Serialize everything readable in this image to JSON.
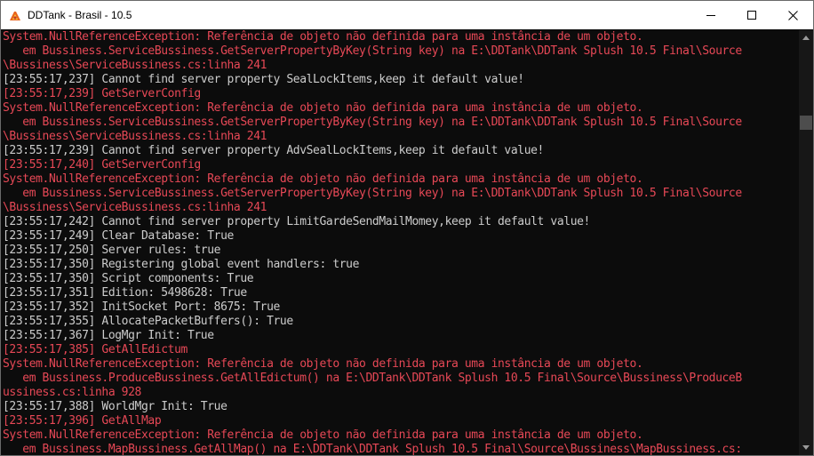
{
  "window": {
    "title": "DDTank - Brasil - 10.5",
    "icon": "ddtank-app-icon",
    "controls": [
      "minimize-icon",
      "maximize-icon",
      "close-icon"
    ]
  },
  "colors": {
    "background": "#0c0c0c",
    "text_normal": "#cccccc",
    "text_error": "#e74856",
    "titlebar": "#ffffff"
  },
  "console": {
    "lines": [
      {
        "text": "System.NullReferenceException: Referência de objeto não definida para uma instância de um objeto.",
        "color": "#e74856"
      },
      {
        "text": "   em Bussiness.ServiceBussiness.GetServerPropertyByKey(String key) na E:\\DDTank\\DDTank Splush 10.5 Final\\Source",
        "color": "#e74856"
      },
      {
        "text": "\\Bussiness\\ServiceBussiness.cs:linha 241",
        "color": "#e74856"
      },
      {
        "text": "[23:55:17,237] Cannot find server property SealLockItems,keep it default value!",
        "color": "#cccccc"
      },
      {
        "text": "[23:55:17,239] GetServerConfig",
        "color": "#e74856"
      },
      {
        "text": "System.NullReferenceException: Referência de objeto não definida para uma instância de um objeto.",
        "color": "#e74856"
      },
      {
        "text": "   em Bussiness.ServiceBussiness.GetServerPropertyByKey(String key) na E:\\DDTank\\DDTank Splush 10.5 Final\\Source",
        "color": "#e74856"
      },
      {
        "text": "\\Bussiness\\ServiceBussiness.cs:linha 241",
        "color": "#e74856"
      },
      {
        "text": "[23:55:17,239] Cannot find server property AdvSealLockItems,keep it default value!",
        "color": "#cccccc"
      },
      {
        "text": "[23:55:17,240] GetServerConfig",
        "color": "#e74856"
      },
      {
        "text": "System.NullReferenceException: Referência de objeto não definida para uma instância de um objeto.",
        "color": "#e74856"
      },
      {
        "text": "   em Bussiness.ServiceBussiness.GetServerPropertyByKey(String key) na E:\\DDTank\\DDTank Splush 10.5 Final\\Source",
        "color": "#e74856"
      },
      {
        "text": "\\Bussiness\\ServiceBussiness.cs:linha 241",
        "color": "#e74856"
      },
      {
        "text": "[23:55:17,242] Cannot find server property LimitGardeSendMailMomey,keep it default value!",
        "color": "#cccccc"
      },
      {
        "text": "[23:55:17,249] Clear Database: True",
        "color": "#cccccc"
      },
      {
        "text": "[23:55:17,250] Server rules: true",
        "color": "#cccccc"
      },
      {
        "text": "[23:55:17,350] Registering global event handlers: true",
        "color": "#cccccc"
      },
      {
        "text": "[23:55:17,350] Script components: True",
        "color": "#cccccc"
      },
      {
        "text": "[23:55:17,351] Edition: 5498628: True",
        "color": "#cccccc"
      },
      {
        "text": "[23:55:17,352] InitSocket Port: 8675: True",
        "color": "#cccccc"
      },
      {
        "text": "[23:55:17,355] AllocatePacketBuffers(): True",
        "color": "#cccccc"
      },
      {
        "text": "[23:55:17,367] LogMgr Init: True",
        "color": "#cccccc"
      },
      {
        "text": "[23:55:17,385] GetAllEdictum",
        "color": "#e74856"
      },
      {
        "text": "System.NullReferenceException: Referência de objeto não definida para uma instância de um objeto.",
        "color": "#e74856"
      },
      {
        "text": "   em Bussiness.ProduceBussiness.GetAllEdictum() na E:\\DDTank\\DDTank Splush 10.5 Final\\Source\\Bussiness\\ProduceB",
        "color": "#e74856"
      },
      {
        "text": "ussiness.cs:linha 928",
        "color": "#e74856"
      },
      {
        "text": "[23:55:17,388] WorldMgr Init: True",
        "color": "#cccccc"
      },
      {
        "text": "[23:55:17,396] GetAllMap",
        "color": "#e74856"
      },
      {
        "text": "System.NullReferenceException: Referência de objeto não definida para uma instância de um objeto.",
        "color": "#e74856"
      },
      {
        "text": "   em Bussiness.MapBussiness.GetAllMap() na E:\\DDTank\\DDTank Splush 10.5 Final\\Source\\Bussiness\\MapBussiness.cs:",
        "color": "#e74856"
      }
    ]
  },
  "scrollbar": {
    "arrows": [
      "scroll-up-icon",
      "scroll-down-icon"
    ]
  }
}
